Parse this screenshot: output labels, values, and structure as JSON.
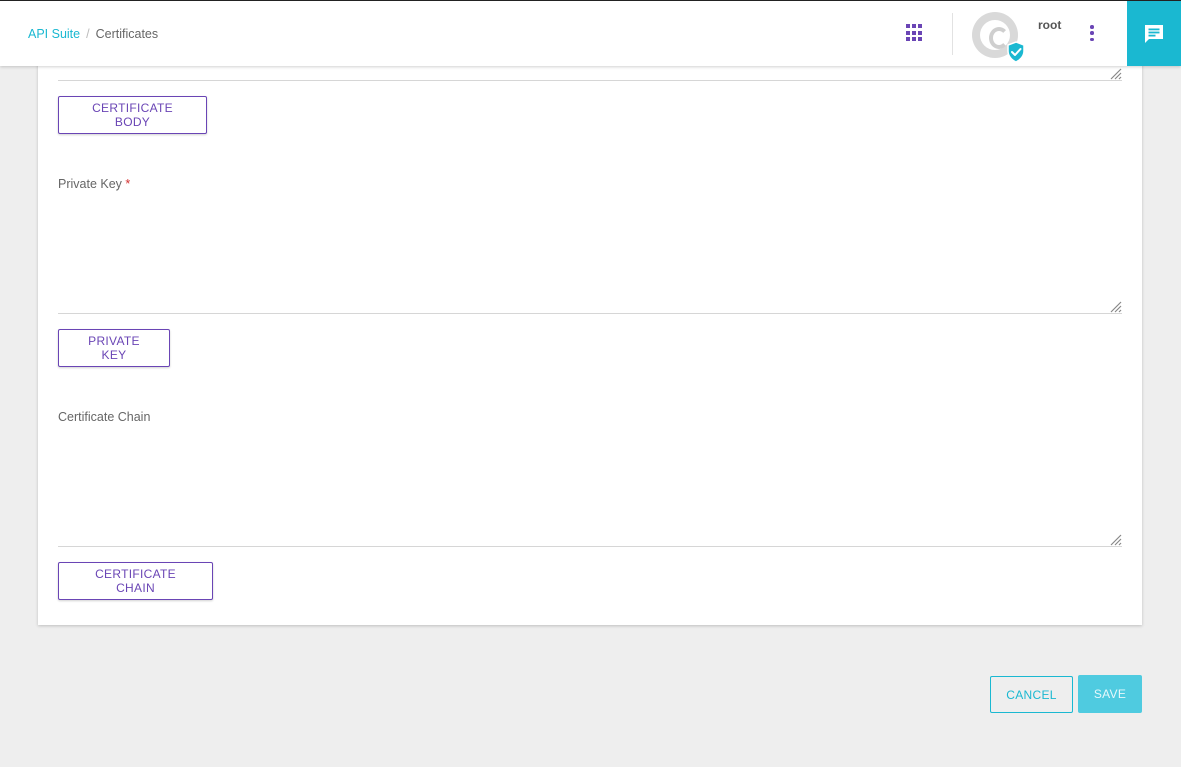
{
  "header": {
    "breadcrumb": {
      "parent": "API Suite",
      "separator": "/",
      "current": "Certificates"
    },
    "user": {
      "name": "root"
    },
    "icons": {
      "apps": "apps-grid-icon",
      "menu": "more-vert-icon",
      "chat": "chat-icon",
      "verified": "verified-shield-icon"
    }
  },
  "form": {
    "certificate_body": {
      "button_label": "CERTIFICATE BODY"
    },
    "private_key": {
      "label": "Private Key",
      "required_mark": "*",
      "button_label": "PRIVATE KEY"
    },
    "certificate_chain": {
      "label": "Certificate Chain",
      "button_label": "CERTIFICATE CHAIN"
    }
  },
  "actions": {
    "cancel_label": "CANCEL",
    "save_label": "SAVE"
  },
  "colors": {
    "accent": "#1ab8d1",
    "primary": "#6a45b5",
    "save_disabled": "#4fcbe0",
    "required": "#d32f2f"
  }
}
